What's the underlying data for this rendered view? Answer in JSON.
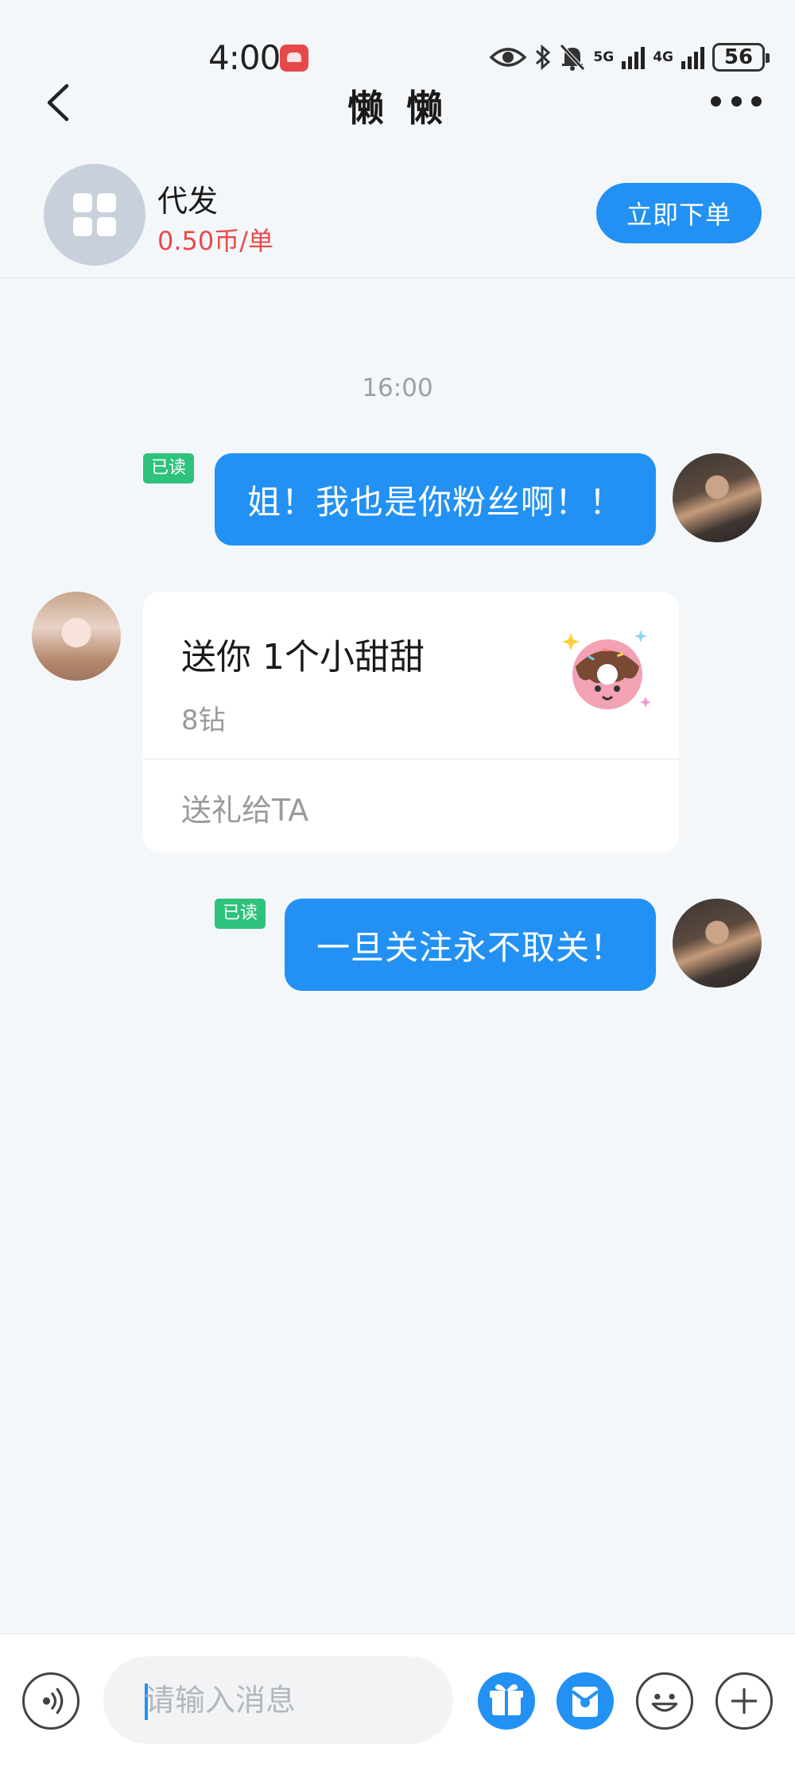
{
  "status_bar": {
    "time": "4:00",
    "network_1": "5G",
    "network_2": "4G",
    "battery": "56"
  },
  "nav": {
    "title": "懒 懒"
  },
  "service": {
    "name": "代发",
    "price": "0.50币/单",
    "order_button": "立即下单"
  },
  "chat": {
    "timestamp": "16:00",
    "messages": [
      {
        "from": "me",
        "read_label": "已读",
        "text": "姐！我也是你粉丝啊！！"
      },
      {
        "from": "other",
        "gift": {
          "title": "送你 1个小甜甜",
          "price": "8钻",
          "action": "送礼给TA"
        }
      },
      {
        "from": "me",
        "read_label": "已读",
        "text": "一旦关注永不取关！"
      }
    ]
  },
  "input_bar": {
    "placeholder": "请输入消息"
  },
  "colors": {
    "accent": "#2291f3",
    "price": "#e84a4a",
    "read_tag": "#2ec27c",
    "background": "#f4f7fa"
  },
  "icons": [
    "eye-icon",
    "bluetooth-icon",
    "mute-bell-icon",
    "back-arrow-icon",
    "more-dots-icon",
    "voice-icon",
    "gift-icon",
    "red-packet-icon",
    "emoji-icon",
    "plus-icon",
    "donut-gift-icon"
  ]
}
